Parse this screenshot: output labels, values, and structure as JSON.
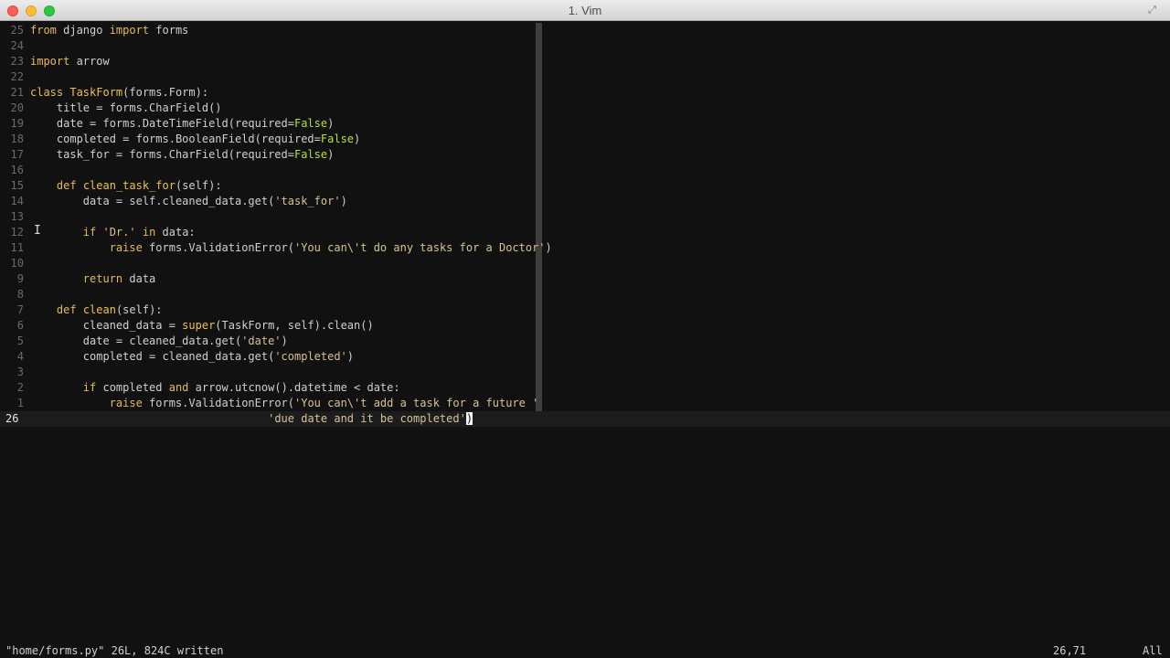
{
  "window": {
    "title": "1. Vim",
    "buttons": [
      "close",
      "minimize",
      "zoom"
    ]
  },
  "editor": {
    "lines": [
      {
        "num": "25",
        "tokens": [
          {
            "t": "from",
            "c": "kw"
          },
          {
            "t": " django "
          },
          {
            "t": "import",
            "c": "kw"
          },
          {
            "t": " forms"
          }
        ]
      },
      {
        "num": "24",
        "tokens": []
      },
      {
        "num": "23",
        "tokens": [
          {
            "t": "import",
            "c": "kw"
          },
          {
            "t": " arrow"
          }
        ]
      },
      {
        "num": "22",
        "tokens": []
      },
      {
        "num": "21",
        "tokens": [
          {
            "t": "class",
            "c": "kw"
          },
          {
            "t": " "
          },
          {
            "t": "TaskForm",
            "c": "fn"
          },
          {
            "t": "(forms.Form):"
          }
        ]
      },
      {
        "num": "20",
        "tokens": [
          {
            "t": "    title = forms.CharField()"
          }
        ]
      },
      {
        "num": "19",
        "tokens": [
          {
            "t": "    date = forms.DateTimeField(required="
          },
          {
            "t": "False",
            "c": "cst"
          },
          {
            "t": ")"
          }
        ]
      },
      {
        "num": "18",
        "tokens": [
          {
            "t": "    completed = forms.BooleanField(required="
          },
          {
            "t": "False",
            "c": "cst"
          },
          {
            "t": ")"
          }
        ]
      },
      {
        "num": "17",
        "tokens": [
          {
            "t": "    task_for = forms.CharField(required="
          },
          {
            "t": "False",
            "c": "cst"
          },
          {
            "t": ")"
          }
        ]
      },
      {
        "num": "16",
        "tokens": []
      },
      {
        "num": "15",
        "tokens": [
          {
            "t": "    "
          },
          {
            "t": "def",
            "c": "kw"
          },
          {
            "t": " "
          },
          {
            "t": "clean_task_for",
            "c": "fn"
          },
          {
            "t": "(self):"
          }
        ]
      },
      {
        "num": "14",
        "tokens": [
          {
            "t": "        data = self.cleaned_data.get("
          },
          {
            "t": "'task_for'",
            "c": "str"
          },
          {
            "t": ")"
          }
        ]
      },
      {
        "num": "13",
        "tokens": []
      },
      {
        "num": "12",
        "tokens": [
          {
            "t": "        "
          },
          {
            "t": "if",
            "c": "kw"
          },
          {
            "t": " "
          },
          {
            "t": "'Dr.'",
            "c": "str"
          },
          {
            "t": " "
          },
          {
            "t": "in",
            "c": "kw"
          },
          {
            "t": " data:"
          }
        ]
      },
      {
        "num": "11",
        "tokens": [
          {
            "t": "            "
          },
          {
            "t": "raise",
            "c": "kw"
          },
          {
            "t": " forms.ValidationError("
          },
          {
            "t": "'You can\\'t do any tasks for a Doctor'",
            "c": "str"
          },
          {
            "t": ")"
          }
        ]
      },
      {
        "num": "10",
        "tokens": []
      },
      {
        "num": "9",
        "tokens": [
          {
            "t": "        "
          },
          {
            "t": "return",
            "c": "kw"
          },
          {
            "t": " data"
          }
        ]
      },
      {
        "num": "8",
        "tokens": []
      },
      {
        "num": "7",
        "tokens": [
          {
            "t": "    "
          },
          {
            "t": "def",
            "c": "kw"
          },
          {
            "t": " "
          },
          {
            "t": "clean",
            "c": "fn"
          },
          {
            "t": "(self):"
          }
        ]
      },
      {
        "num": "6",
        "tokens": [
          {
            "t": "        cleaned_data = "
          },
          {
            "t": "super",
            "c": "fn"
          },
          {
            "t": "(TaskForm, self).clean()"
          }
        ]
      },
      {
        "num": "5",
        "tokens": [
          {
            "t": "        date = cleaned_data.get("
          },
          {
            "t": "'date'",
            "c": "str"
          },
          {
            "t": ")"
          }
        ]
      },
      {
        "num": "4",
        "tokens": [
          {
            "t": "        completed = cleaned_data.get("
          },
          {
            "t": "'completed'",
            "c": "str"
          },
          {
            "t": ")"
          }
        ]
      },
      {
        "num": "3",
        "tokens": []
      },
      {
        "num": "2",
        "tokens": [
          {
            "t": "        "
          },
          {
            "t": "if",
            "c": "kw"
          },
          {
            "t": " completed "
          },
          {
            "t": "and",
            "c": "kw"
          },
          {
            "t": " arrow.utcnow().datetime < date:"
          }
        ]
      },
      {
        "num": "1",
        "tokens": [
          {
            "t": "            "
          },
          {
            "t": "raise",
            "c": "kw"
          },
          {
            "t": " forms.ValidationError("
          },
          {
            "t": "'You can\\'t add a task for a future '",
            "c": "str"
          }
        ]
      },
      {
        "num": "26",
        "current": true,
        "tokens": [
          {
            "t": "                                    "
          },
          {
            "t": "'due date and it be completed'",
            "c": "str"
          },
          {
            "t": ")",
            "c": "cursor"
          }
        ]
      }
    ]
  },
  "statusline": {
    "message": "\"home/forms.py\" 26L, 824C written",
    "position": "26,71",
    "scroll": "All"
  }
}
